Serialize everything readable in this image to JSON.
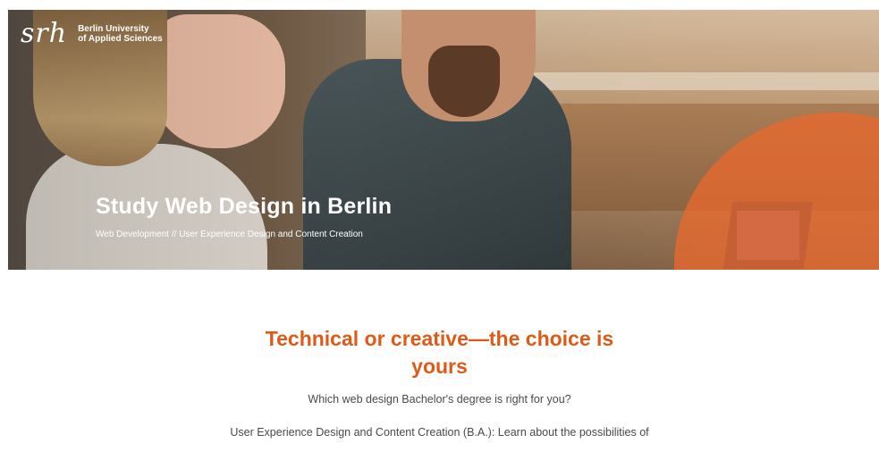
{
  "logo": {
    "mark": "srh",
    "line1": "Berlin University",
    "line2": "of Applied Sciences"
  },
  "hero": {
    "title": "Study Web Design in Berlin",
    "subtitle": "Web Development // User Experience Design and Content Creation"
  },
  "content": {
    "headline_line1": "Technical or creative—the choice is",
    "headline_line2": "yours",
    "question": "Which web design Bachelor's degree is right for you?",
    "intro": "User Experience Design and Content Creation (B.A.): Learn about the possibilities of"
  },
  "colors": {
    "accent": "#df5a17",
    "body_text": "#4a4a4a",
    "hero_overlay": "#e8692e"
  }
}
